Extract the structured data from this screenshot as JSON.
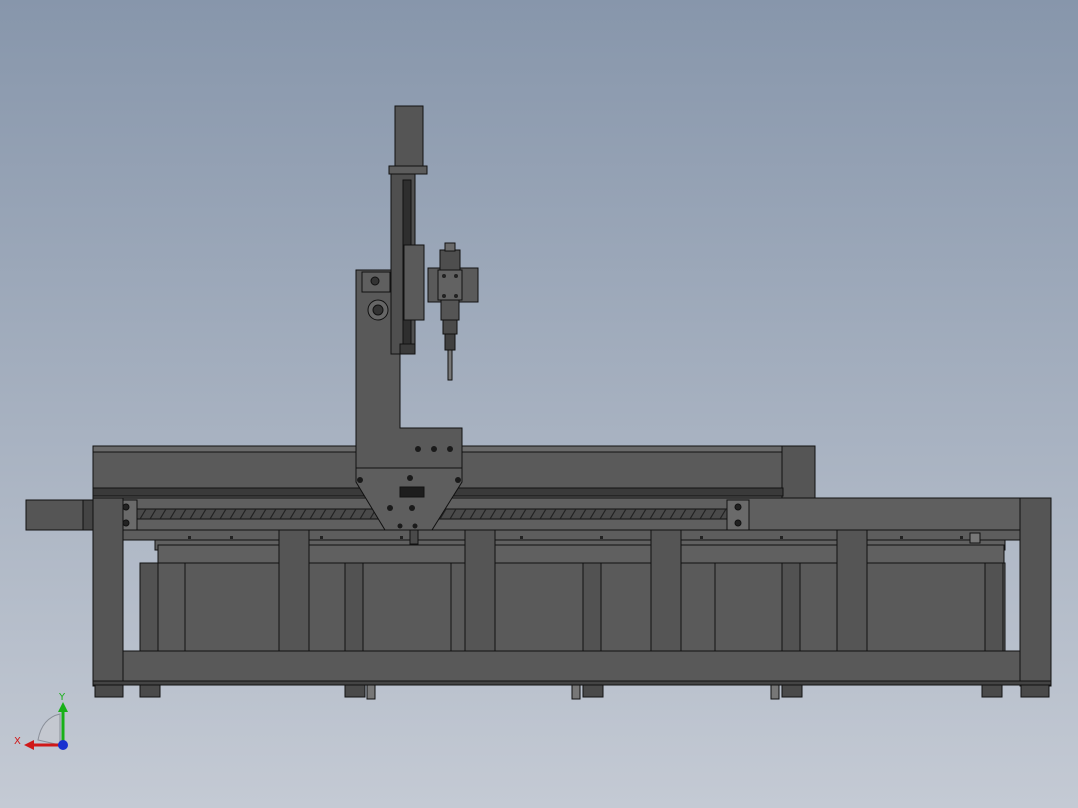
{
  "view": {
    "background_top": "#8796ab",
    "background_bottom": "#c4cad4",
    "part_fill": "#5a5a5a",
    "part_dark": "#3c3c3c",
    "edge_color": "#111111"
  },
  "triad": {
    "x_label": "X",
    "y_label": "Y",
    "x_color": "#d01818",
    "y_color": "#18b018",
    "z_color": "#1830d0"
  }
}
